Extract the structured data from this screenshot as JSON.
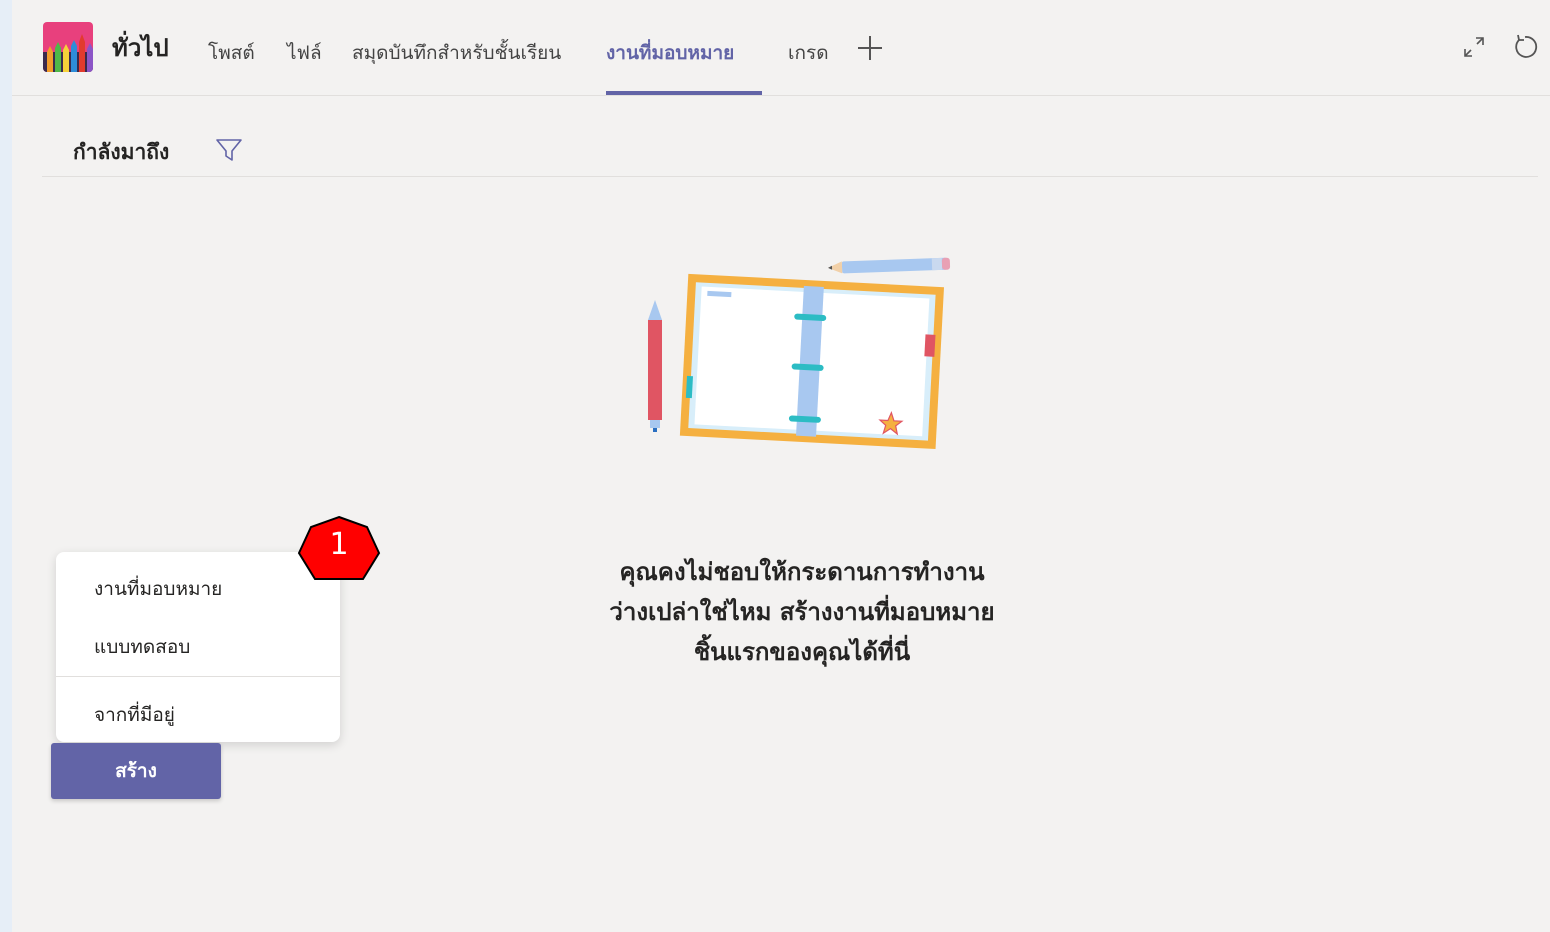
{
  "header": {
    "team_logo": "colored-pencils-logo",
    "channel_title": "ทั่วไป",
    "tabs": [
      {
        "label": "โพสต์",
        "active": false
      },
      {
        "label": "ไฟล์",
        "active": false
      },
      {
        "label": "สมุดบันทึกสำหรับชั้นเรียน",
        "active": false
      },
      {
        "label": "งานที่มอบหมาย",
        "active": true
      },
      {
        "label": "เกรด",
        "active": false
      }
    ],
    "add_tab_icon": "plus-icon",
    "expand_icon": "expand-icon",
    "refresh_icon": "refresh-icon"
  },
  "filter_bar": {
    "label": "กำลังมาถึง",
    "icon": "filter-icon"
  },
  "empty_state": {
    "illustration": "open-planner-with-pencils",
    "message_lines": [
      "คุณคงไม่ชอบให้กระดานการทำงาน",
      "ว่างเปล่าใช่ไหม สร้างงานที่มอบหมาย",
      "ชิ้นแรกของคุณได้ที่นี่"
    ]
  },
  "create_menu": {
    "items": [
      {
        "label": "งานที่มอบหมาย"
      },
      {
        "label": "แบบทดสอบ"
      },
      {
        "label": "จากที่มีอยู่"
      }
    ]
  },
  "create_button": {
    "label": "สร้าง"
  },
  "callout": {
    "number": "1",
    "color": "#ff0000"
  },
  "colors": {
    "accent": "#6264a7",
    "background": "#f3f2f1"
  }
}
